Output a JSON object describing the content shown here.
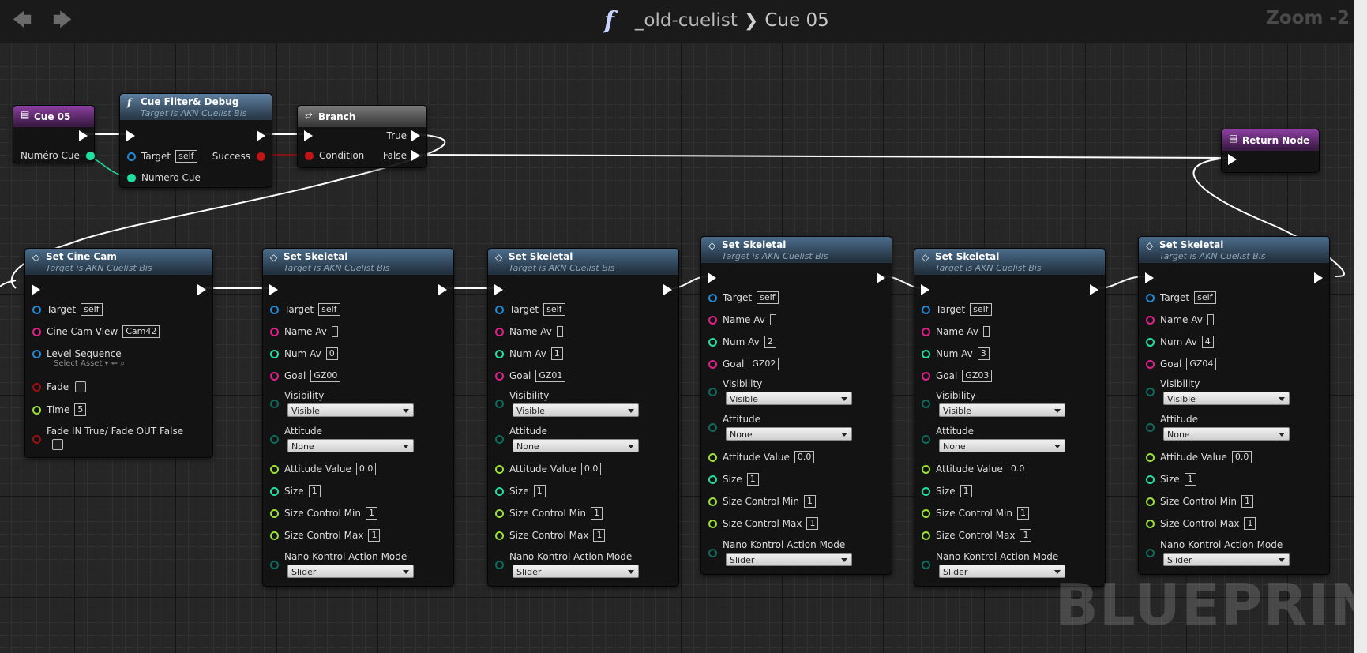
{
  "breadcrumb": {
    "function": "_old-cuelist",
    "current": "Cue 05"
  },
  "zoom": "Zoom -2",
  "watermark": "BLUEPRINT",
  "entry_node": {
    "title": "Cue 05",
    "pin_label": "Numéro Cue"
  },
  "filter_node": {
    "title": "Cue Filter& Debug",
    "subtitle": "Target is AKN Cuelist Bis",
    "target_label": "Target",
    "target_value": "self",
    "success_label": "Success",
    "numero_label": "Numero Cue"
  },
  "branch_node": {
    "title": "Branch",
    "true_label": "True",
    "false_label": "False",
    "condition_label": "Condition"
  },
  "return_node": {
    "title": "Return Node"
  },
  "cinecam_node": {
    "title": "Set Cine Cam",
    "subtitle": "Target is AKN Cuelist Bis",
    "target_label": "Target",
    "target_value": "self",
    "view_label": "Cine Cam View",
    "view_value": "Cam42",
    "seq_label": "Level Sequence",
    "seq_placeholder": "Select Asset",
    "fade_label": "Fade",
    "time_label": "Time",
    "time_value": "5",
    "fadein_label": "Fade IN True/ Fade OUT False"
  },
  "skeletal_labels": {
    "title": "Set Skeletal",
    "subtitle": "Target is AKN Cuelist Bis",
    "target": "Target",
    "name_av": "Name Av",
    "num_av": "Num Av",
    "goal": "Goal",
    "visibility": "Visibility",
    "attitude": "Attitude",
    "attitude_value": "Attitude Value",
    "size": "Size",
    "size_min": "Size Control Min",
    "size_max": "Size Control Max",
    "nano": "Nano Kontrol Action Mode"
  },
  "skeletal_nodes": [
    {
      "target": "self",
      "num_av": "0",
      "goal": "GZ00",
      "visibility": "Visible",
      "attitude": "None",
      "attitude_value": "0.0",
      "size": "1",
      "size_min": "1",
      "size_max": "1",
      "nano": "Slider"
    },
    {
      "target": "self",
      "num_av": "1",
      "goal": "GZ01",
      "visibility": "Visible",
      "attitude": "None",
      "attitude_value": "0.0",
      "size": "1",
      "size_min": "1",
      "size_max": "1",
      "nano": "Slider"
    },
    {
      "target": "self",
      "num_av": "2",
      "goal": "GZ02",
      "visibility": "Visible",
      "attitude": "None",
      "attitude_value": "0.0",
      "size": "1",
      "size_min": "1",
      "size_max": "1",
      "nano": "Slider"
    },
    {
      "target": "self",
      "num_av": "3",
      "goal": "GZ03",
      "visibility": "Visible",
      "attitude": "None",
      "attitude_value": "0.0",
      "size": "1",
      "size_min": "1",
      "size_max": "1",
      "nano": "Slider"
    },
    {
      "target": "self",
      "num_av": "4",
      "goal": "GZ04",
      "visibility": "Visible",
      "attitude": "None",
      "attitude_value": "0.0",
      "size": "1",
      "size_min": "1",
      "size_max": "1",
      "nano": "Slider"
    }
  ],
  "colors": {
    "object_pin": "#1f8ad6",
    "string_pin": "#e0208a",
    "int_pin": "#1fe0a0",
    "float_pin": "#9be035",
    "bool_pin": "#9b0f0f",
    "enum_pin": "#0d6b5d",
    "purple_header": "#8c3fa0",
    "blue_header": "#4a6d8c"
  }
}
